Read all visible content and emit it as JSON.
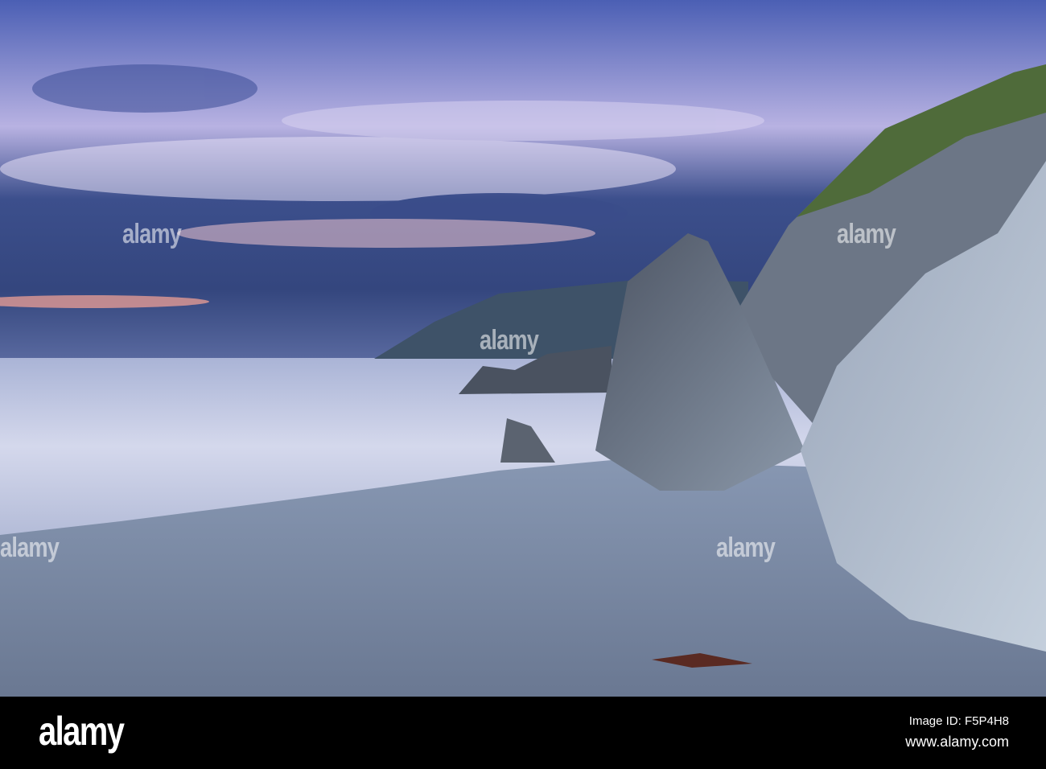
{
  "photo": {
    "subject": "Long-exposure coastal beach scene at dusk",
    "colors": {
      "sky_top": "#4a5aa8",
      "sky_mid": "#b9b3e0",
      "horizon_pink": "#e79a9a",
      "sea": "#c9d0e6",
      "beach": "#7d8ea8",
      "rock": "#5f6a78",
      "grass": "#4f6b3a"
    }
  },
  "watermark": {
    "text": "alamy"
  },
  "footer": {
    "logo": "alamy",
    "image_id": "Image ID: F5P4H8",
    "website": "www.alamy.com"
  }
}
